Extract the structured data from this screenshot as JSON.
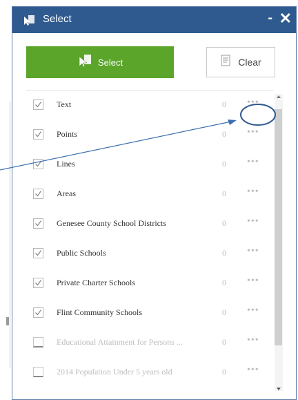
{
  "window": {
    "title": "Select",
    "minimize_label": "-",
    "close_label": "✕"
  },
  "toolbar": {
    "select_label": "Select",
    "clear_label": "Clear"
  },
  "layers": [
    {
      "label": "Text",
      "count": "0",
      "more": "•••",
      "checked": true,
      "enabled": true
    },
    {
      "label": "Points",
      "count": "0",
      "more": "•••",
      "checked": true,
      "enabled": true
    },
    {
      "label": "Lines",
      "count": "0",
      "more": "•••",
      "checked": true,
      "enabled": true
    },
    {
      "label": "Areas",
      "count": "0",
      "more": "•••",
      "checked": true,
      "enabled": true
    },
    {
      "label": "Genesee County School Districts",
      "count": "0",
      "more": "•••",
      "checked": true,
      "enabled": true
    },
    {
      "label": "Public Schools",
      "count": "0",
      "more": "•••",
      "checked": true,
      "enabled": true
    },
    {
      "label": "Private Charter Schools",
      "count": "0",
      "more": "•••",
      "checked": true,
      "enabled": true
    },
    {
      "label": "Flint Community Schools",
      "count": "0",
      "more": "•••",
      "checked": true,
      "enabled": true
    },
    {
      "label": "Educational Attainment for Persons ...",
      "count": "0",
      "more": "•••",
      "checked": false,
      "enabled": false
    },
    {
      "label": "2014 Population Under 5 years old",
      "count": "0",
      "more": "•••",
      "checked": false,
      "enabled": false
    }
  ],
  "colors": {
    "titlebar": "#2f5a90",
    "select_button": "#5aa52a",
    "annotation": "#2f5a90"
  }
}
